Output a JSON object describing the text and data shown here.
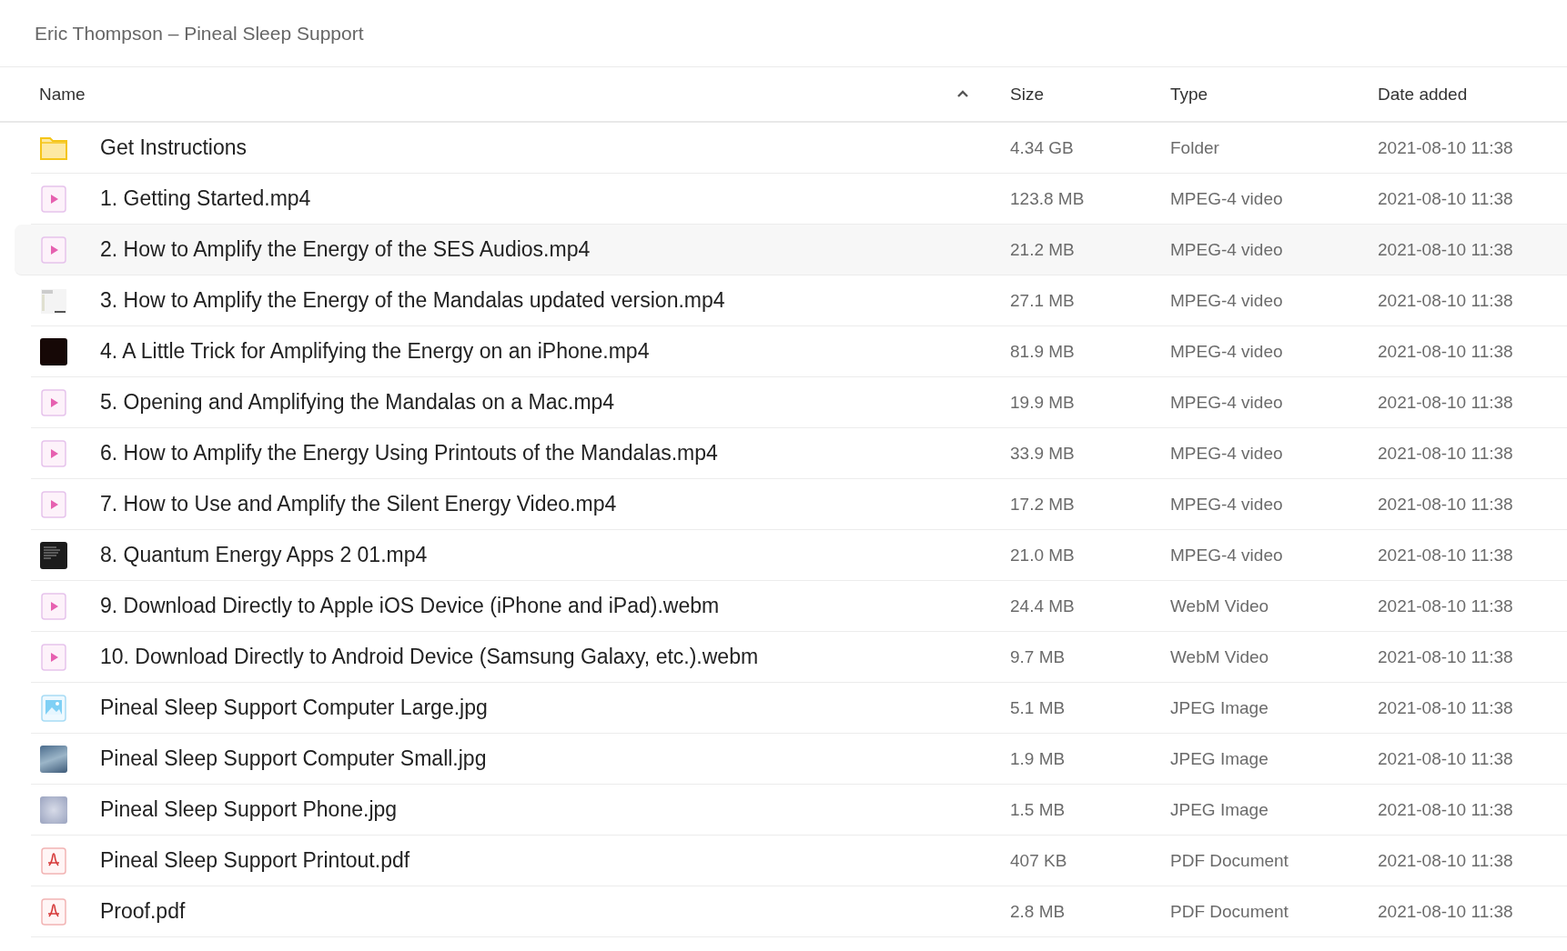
{
  "title": "Eric Thompson – Pineal Sleep Support",
  "columns": [
    {
      "label": "Name",
      "sorted": true
    },
    {
      "label": "Size",
      "sorted": false
    },
    {
      "label": "Type",
      "sorted": false
    },
    {
      "label": "Date added",
      "sorted": false
    }
  ],
  "rows": [
    {
      "kind": "folder",
      "name": "Get Instructions",
      "size": "4.34 GB",
      "type": "Folder",
      "date": "2021-08-10 11:38",
      "selected": false
    },
    {
      "kind": "video",
      "name": "1. Getting Started.mp4",
      "size": "123.8 MB",
      "type": "MPEG-4 video",
      "date": "2021-08-10 11:38",
      "selected": false
    },
    {
      "kind": "video",
      "name": "2. How to Amplify the Energy of the SES Audios.mp4",
      "size": "21.2 MB",
      "type": "MPEG-4 video",
      "date": "2021-08-10 11:38",
      "selected": true
    },
    {
      "kind": "screenshot",
      "name": "3. How to Amplify the Energy of the Mandalas updated version.mp4",
      "size": "27.1 MB",
      "type": "MPEG-4 video",
      "date": "2021-08-10 11:38",
      "selected": false
    },
    {
      "kind": "dark",
      "name": "4. A Little Trick for Amplifying the Energy on an iPhone.mp4",
      "size": "81.9 MB",
      "type": "MPEG-4 video",
      "date": "2021-08-10 11:38",
      "selected": false
    },
    {
      "kind": "video",
      "name": "5. Opening and Amplifying the Mandalas on a Mac.mp4",
      "size": "19.9 MB",
      "type": "MPEG-4 video",
      "date": "2021-08-10 11:38",
      "selected": false
    },
    {
      "kind": "video",
      "name": "6. How to Amplify the Energy Using Printouts of the Mandalas.mp4",
      "size": "33.9 MB",
      "type": "MPEG-4 video",
      "date": "2021-08-10 11:38",
      "selected": false
    },
    {
      "kind": "video",
      "name": "7. How to Use and Amplify the Silent Energy Video.mp4",
      "size": "17.2 MB",
      "type": "MPEG-4 video",
      "date": "2021-08-10 11:38",
      "selected": false
    },
    {
      "kind": "textframe",
      "name": "8. Quantum Energy Apps 2 01.mp4",
      "size": "21.0 MB",
      "type": "MPEG-4 video",
      "date": "2021-08-10 11:38",
      "selected": false
    },
    {
      "kind": "video",
      "name": "9. Download Directly to Apple iOS Device (iPhone and iPad).webm",
      "size": "24.4 MB",
      "type": "WebM Video",
      "date": "2021-08-10 11:38",
      "selected": false
    },
    {
      "kind": "video",
      "name": "10. Download Directly to Android Device (Samsung Galaxy, etc.).webm",
      "size": "9.7 MB",
      "type": "WebM Video",
      "date": "2021-08-10 11:38",
      "selected": false
    },
    {
      "kind": "image",
      "name": "Pineal Sleep Support Computer Large.jpg",
      "size": "5.1 MB",
      "type": "JPEG Image",
      "date": "2021-08-10 11:38",
      "selected": false
    },
    {
      "kind": "photo",
      "name": "Pineal Sleep Support Computer Small.jpg",
      "size": "1.9 MB",
      "type": "JPEG Image",
      "date": "2021-08-10 11:38",
      "selected": false
    },
    {
      "kind": "pattern",
      "name": "Pineal Sleep Support Phone.jpg",
      "size": "1.5 MB",
      "type": "JPEG Image",
      "date": "2021-08-10 11:38",
      "selected": false
    },
    {
      "kind": "pdf",
      "name": "Pineal Sleep Support Printout.pdf",
      "size": "407 KB",
      "type": "PDF Document",
      "date": "2021-08-10 11:38",
      "selected": false
    },
    {
      "kind": "pdf",
      "name": "Proof.pdf",
      "size": "2.8 MB",
      "type": "PDF Document",
      "date": "2021-08-10 11:38",
      "selected": false
    }
  ]
}
